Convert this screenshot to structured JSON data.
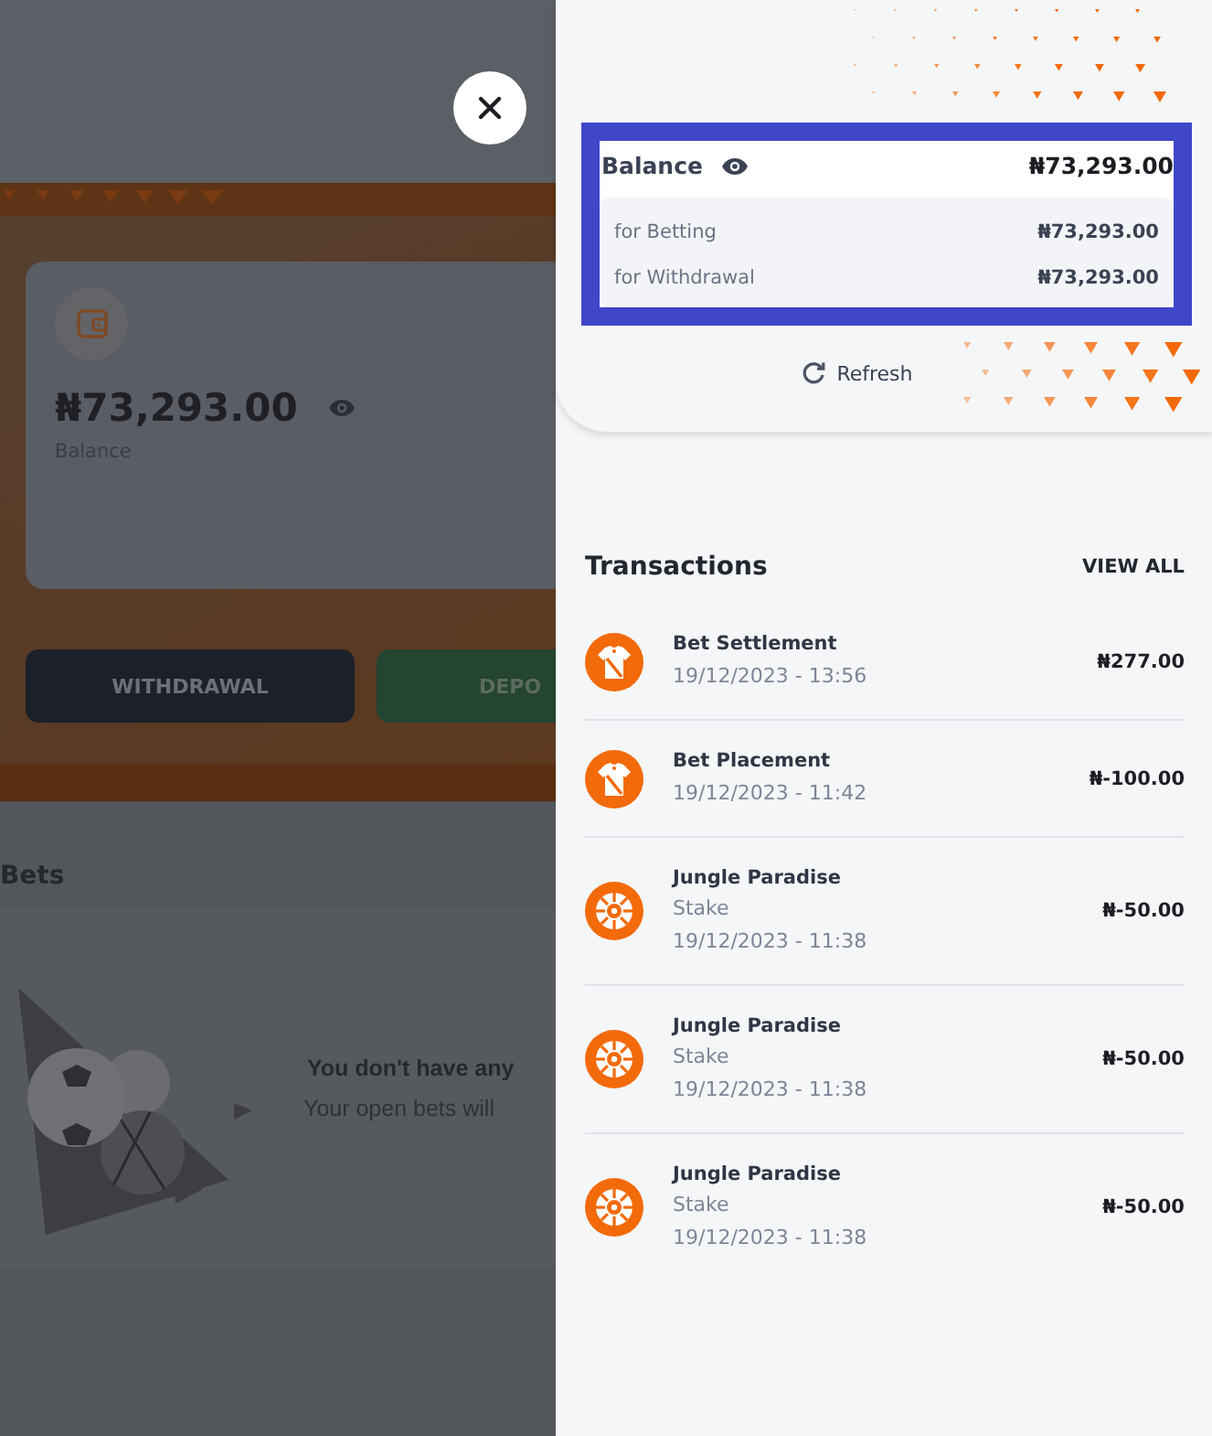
{
  "background_page": {
    "balance_card": {
      "amount": "₦73,293.00",
      "label": "Balance"
    },
    "buttons": [
      {
        "kind": "dark",
        "label": "WITHDRAWAL"
      },
      {
        "kind": "green",
        "label": "DEPO"
      }
    ],
    "bets": {
      "title": "Bets",
      "empty_title": "You don't have any",
      "empty_text": "Your open bets will"
    }
  },
  "drawer": {
    "balance": {
      "title": "Balance",
      "total": "₦73,293.00",
      "rows": [
        {
          "label": "for Betting",
          "amount": "₦73,293.00"
        },
        {
          "label": "for Withdrawal",
          "amount": "₦73,293.00"
        }
      ],
      "refresh": "Refresh"
    },
    "transactions": {
      "title": "Transactions",
      "view_all": "VIEW ALL",
      "items": [
        {
          "kind": "bet",
          "title": "Bet Settlement",
          "date": "19/12/2023 - 13:56",
          "amount": "₦277.00"
        },
        {
          "kind": "bet",
          "title": "Bet Placement",
          "date": "19/12/2023 - 11:42",
          "amount": "₦-100.00"
        },
        {
          "kind": "game",
          "title": "Jungle Paradise",
          "subtitle": "Stake",
          "date": "19/12/2023 - 11:38",
          "amount": "₦-50.00"
        },
        {
          "kind": "game",
          "title": "Jungle Paradise",
          "subtitle": "Stake",
          "date": "19/12/2023 - 11:38",
          "amount": "₦-50.00"
        },
        {
          "kind": "game",
          "title": "Jungle Paradise",
          "subtitle": "Stake",
          "date": "19/12/2023 - 11:38",
          "amount": "₦-50.00"
        }
      ]
    }
  }
}
